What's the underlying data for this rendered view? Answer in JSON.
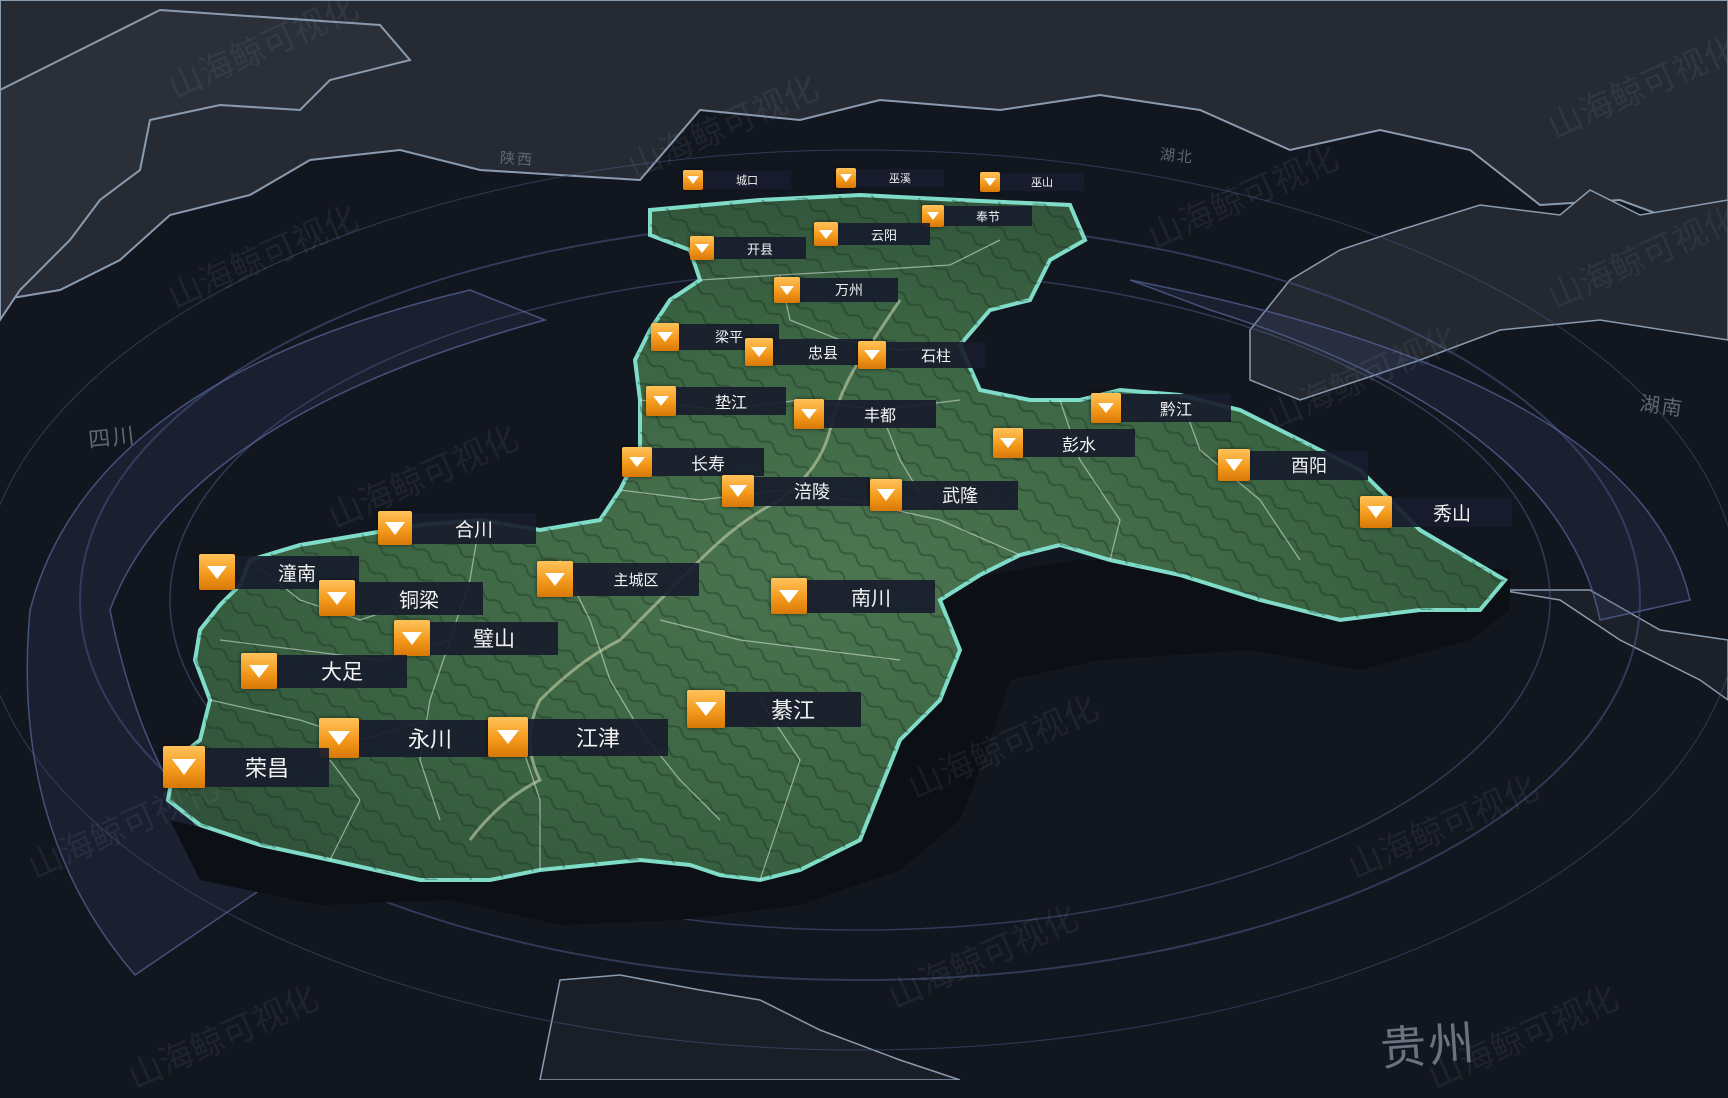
{
  "map": {
    "province_labels": {
      "shaanxi": "陕西",
      "hubei": "湖北",
      "sichuan": "四川",
      "hunan": "湖南",
      "guizhou": "贵州"
    },
    "watermark": "山海鲸可视化",
    "markers": [
      {
        "id": "chengkou",
        "name": "城口"
      },
      {
        "id": "wuxi",
        "name": "巫溪"
      },
      {
        "id": "wushan",
        "name": "巫山"
      },
      {
        "id": "fengjie",
        "name": "奉节"
      },
      {
        "id": "kaixian",
        "name": "开县"
      },
      {
        "id": "yunyang",
        "name": "云阳"
      },
      {
        "id": "wanzhou",
        "name": "万州"
      },
      {
        "id": "liangping",
        "name": "梁平"
      },
      {
        "id": "zhongxian",
        "name": "忠县"
      },
      {
        "id": "shizhu",
        "name": "石柱"
      },
      {
        "id": "dianjiang",
        "name": "垫江"
      },
      {
        "id": "fengdu",
        "name": "丰都"
      },
      {
        "id": "qianjiang",
        "name": "黔江"
      },
      {
        "id": "pengshui",
        "name": "彭水"
      },
      {
        "id": "changshou",
        "name": "长寿"
      },
      {
        "id": "fuling",
        "name": "涪陵"
      },
      {
        "id": "wulong",
        "name": "武隆"
      },
      {
        "id": "youyang",
        "name": "酉阳"
      },
      {
        "id": "xiushan",
        "name": "秀山"
      },
      {
        "id": "hechuan",
        "name": "合川"
      },
      {
        "id": "tongnan",
        "name": "潼南"
      },
      {
        "id": "zhuchengqu",
        "name": "主城区"
      },
      {
        "id": "tongliang",
        "name": "铜梁"
      },
      {
        "id": "nanchuan",
        "name": "南川"
      },
      {
        "id": "bishan",
        "name": "璧山"
      },
      {
        "id": "dazu",
        "name": "大足"
      },
      {
        "id": "qijiang",
        "name": "綦江"
      },
      {
        "id": "yongchuan",
        "name": "永川"
      },
      {
        "id": "jiangjin",
        "name": "江津"
      },
      {
        "id": "rongchang",
        "name": "荣昌"
      }
    ]
  },
  "colors": {
    "background": "#12161e",
    "neighbor_land": "#222832",
    "neighbor_border": "#8a9bb0",
    "region_fill": "#3d6a45",
    "region_outline": "#7fdcc8",
    "marker_orange": "#f49a1c",
    "label_bg": "#181c2c",
    "label_text": "#f3f3f3",
    "ring": "#4a5a86"
  }
}
